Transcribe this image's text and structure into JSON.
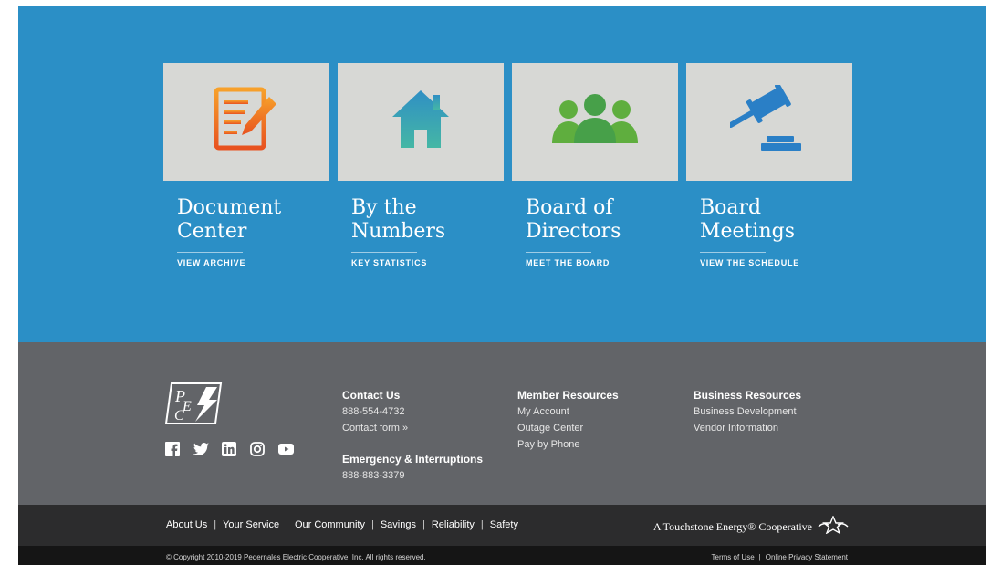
{
  "cards": [
    {
      "title_line1": "Document",
      "title_line2": "Center",
      "link": "VIEW ARCHIVE",
      "icon": "document-edit-icon"
    },
    {
      "title_line1": "By the",
      "title_line2": "Numbers",
      "link": "KEY STATISTICS",
      "icon": "house-icon"
    },
    {
      "title_line1": "Board of",
      "title_line2": "Directors",
      "link": "MEET THE BOARD",
      "icon": "people-group-icon"
    },
    {
      "title_line1": "Board",
      "title_line2": "Meetings",
      "link": "VIEW THE SCHEDULE",
      "icon": "gavel-icon"
    }
  ],
  "footer": {
    "logo_text": "PEC",
    "social": [
      "facebook-icon",
      "twitter-icon",
      "linkedin-icon",
      "instagram-icon",
      "youtube-icon"
    ],
    "contact": {
      "heading": "Contact Us",
      "phone": "888-554-4732",
      "form_link": "Contact form »",
      "emergency_heading": "Emergency & Interruptions",
      "emergency_phone": "888-883-3379"
    },
    "member": {
      "heading": "Member Resources",
      "links": [
        "My Account",
        "Outage Center",
        "Pay by Phone"
      ]
    },
    "business": {
      "heading": "Business Resources",
      "links": [
        "Business Development",
        "Vendor Information"
      ]
    }
  },
  "nav": {
    "links": [
      "About Us",
      "Your Service",
      "Our Community",
      "Savings",
      "Reliability",
      "Safety"
    ],
    "separator": "|",
    "touchstone": "A Touchstone Energy® Cooperative"
  },
  "legal": {
    "copyright": "© Copyright 2010-2019 Pedernales Electric Cooperative, Inc. All rights reserved.",
    "terms": "Terms of Use",
    "privacy": "Online Privacy Statement",
    "separator": "|"
  },
  "colors": {
    "hero": "#2b8fc6",
    "footer": "#626468",
    "navbar": "#2c2c2d",
    "copybar": "#151515",
    "tile": "#d7d8d5",
    "doc_orange": "#f08a24",
    "house_teal": "#3aa3b3",
    "people_green": "#5fae3e",
    "gavel_blue": "#2a7fc6"
  }
}
